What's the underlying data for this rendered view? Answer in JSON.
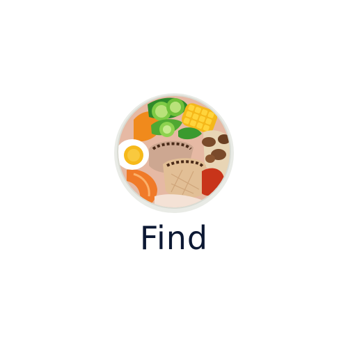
{
  "app": {
    "name": "Find",
    "logo_icon": "food-bowl-icon"
  },
  "colors": {
    "text": "#0c1833",
    "background": "#ffffff"
  }
}
